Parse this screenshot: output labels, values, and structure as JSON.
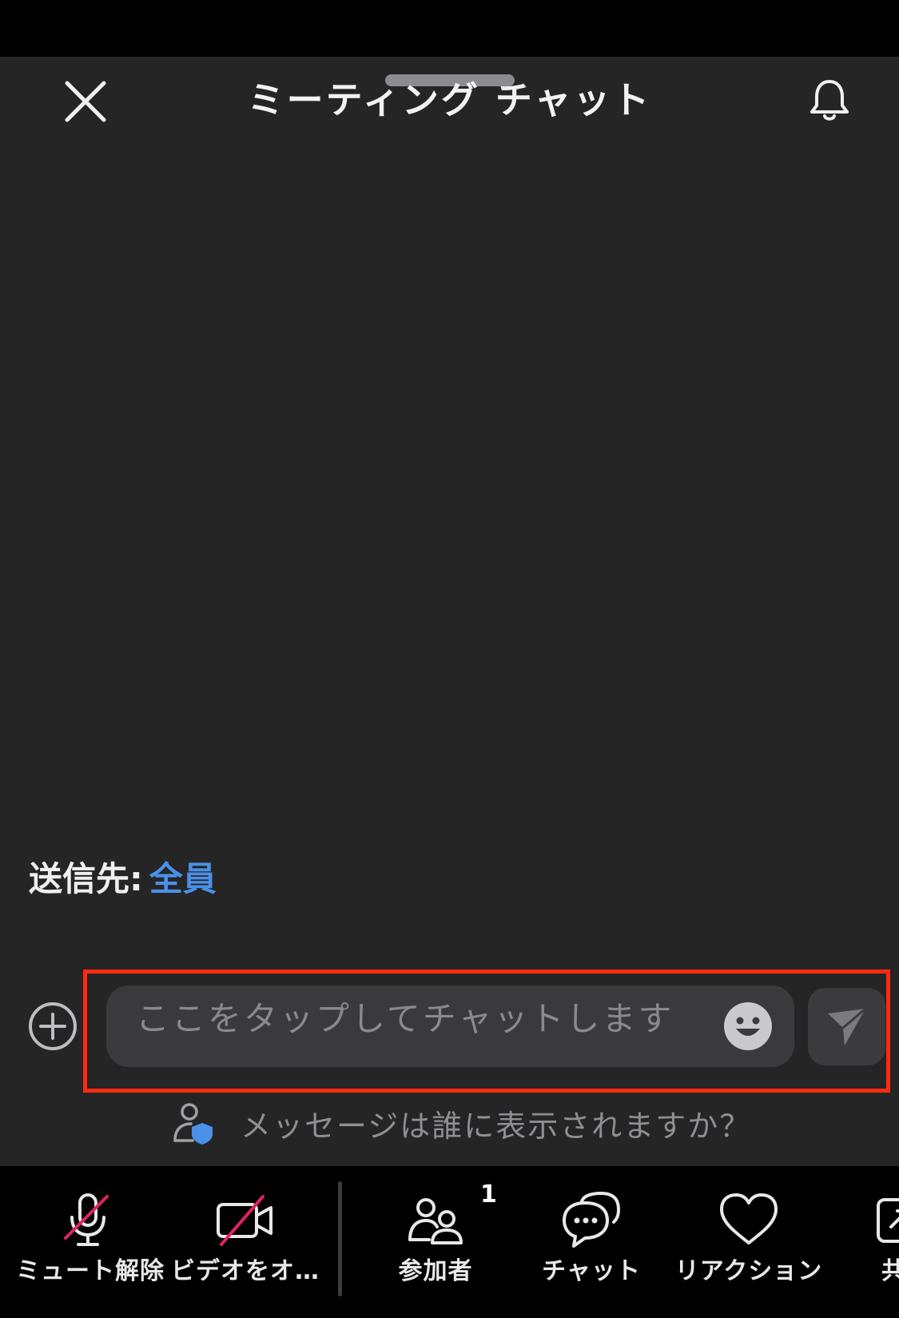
{
  "header": {
    "title": "ミーティング チャット",
    "close_icon": "close-icon",
    "bell_icon": "bell-icon"
  },
  "recipient": {
    "prefix": "送信先:",
    "target": "全員"
  },
  "composer": {
    "placeholder": "ここをタップしてチャットします",
    "add_icon": "plus-circle-icon",
    "emoji_icon": "emoji-icon",
    "send_icon": "send-icon"
  },
  "privacy": {
    "text": "メッセージは誰に表示されますか？",
    "icon": "person-shield-icon"
  },
  "toolbar": {
    "items": [
      {
        "label": "ミュート解除",
        "icon": "mic-muted-icon"
      },
      {
        "label": "ビデオをオ…",
        "icon": "video-off-icon"
      },
      {
        "label": "参加者",
        "icon": "participants-icon",
        "badge": "1"
      },
      {
        "label": "チャット",
        "icon": "chat-icon"
      },
      {
        "label": "リアクション",
        "icon": "heart-icon"
      },
      {
        "label": "共",
        "icon": "share-icon"
      }
    ]
  },
  "colors": {
    "sheet_bg": "#252526",
    "accent_blue": "#4a90e8",
    "highlight_red": "#ff2a10",
    "muted_red": "#e0245e"
  }
}
